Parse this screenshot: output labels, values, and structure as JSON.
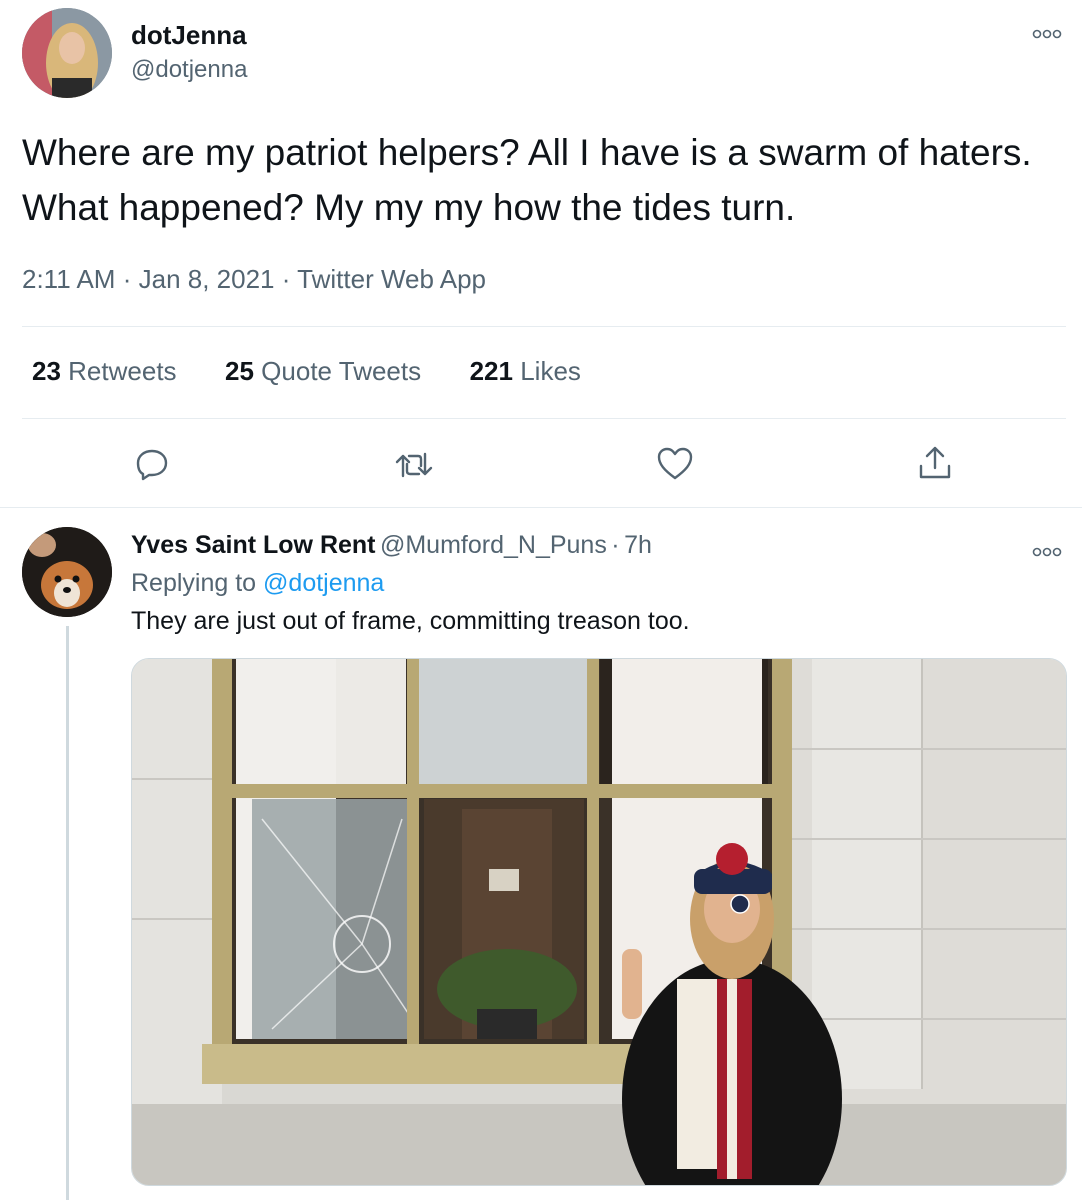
{
  "main_tweet": {
    "author_name": "dotJenna",
    "author_handle": "@dotjenna",
    "text": "Where are my patriot helpers? All I have is a swarm of haters. What happened? My my my how the tides turn.",
    "time": "2:11 AM",
    "date": "Jan 8, 2021",
    "source": "Twitter Web App",
    "separator": "·",
    "stats": {
      "retweets_count": "23",
      "retweets_label": "Retweets",
      "quotes_count": "25",
      "quotes_label": "Quote Tweets",
      "likes_count": "221",
      "likes_label": "Likes"
    },
    "actions": [
      "reply-icon",
      "retweet-icon",
      "like-icon",
      "share-icon"
    ]
  },
  "reply_tweet": {
    "author_name": "Yves Saint Low Rent",
    "author_handle": "@Mumford_N_Puns",
    "separator": "·",
    "age": "7h",
    "replying_prefix": "Replying to",
    "replying_handle": "@dotjenna",
    "text": "They are just out of frame, committing treason too."
  },
  "colors": {
    "link": "#1d9bf0",
    "muted": "#536471",
    "text": "#0f1419",
    "divider": "#e6ecf0"
  }
}
